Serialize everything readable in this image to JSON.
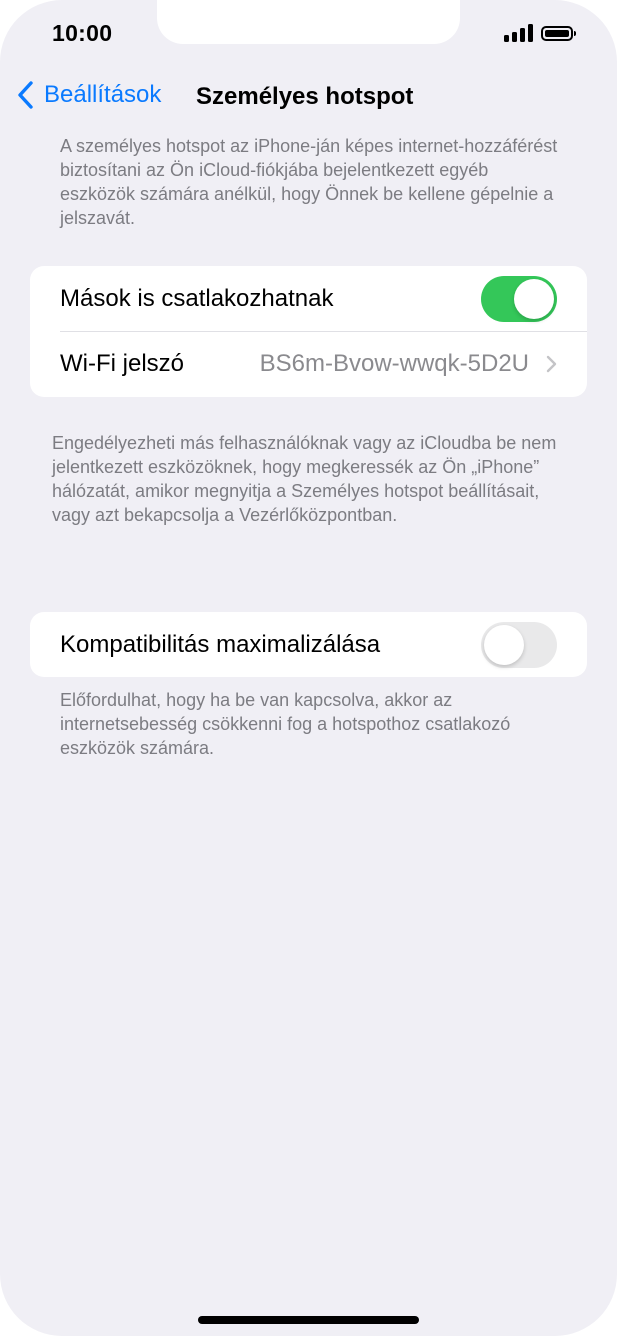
{
  "status_bar": {
    "time": "10:00",
    "signal_icon": "cellular-signal-icon",
    "battery_icon": "battery-icon",
    "battery_level": 1.0
  },
  "nav": {
    "back_label": "Beállítások",
    "back_icon": "chevron-left-icon",
    "title": "Személyes hotspot",
    "accent_color": "#0a7aff"
  },
  "intro_text": "A személyes hotspot az iPhone-ján képes internet-hozzáférést biztosítani az Ön iCloud-fiókjába bejelentkezett egyéb eszközök számára anélkül, hogy Önnek be kellene gépelnie a jelszavát.",
  "settings_group_1": {
    "allow_others": {
      "label": "Mások is csatlakozhatnak",
      "enabled": true,
      "on_color": "#34c759"
    },
    "wifi_password": {
      "label": "Wi-Fi jelszó",
      "value": "BS6m-Bvow-wwqk-5D2U",
      "chevron_icon": "chevron-right-icon"
    }
  },
  "allow_others_footer": "Engedélyezheti más felhasználóknak vagy az iCloudba be nem jelentkezett eszközöknek, hogy megkeressék az Ön „iPhone” hálózatát, amikor megnyitja a Személyes hotspot beállításait, vagy azt bekapcsolja a Vezérlőközpontban.",
  "settings_group_2": {
    "maximize_compatibility": {
      "label": "Kompatibilitás maximalizálása",
      "enabled": false
    }
  },
  "compatibility_footer": "Előfordulhat, hogy ha be van kapcsolva, akkor az internetsebesség csökkenni fog a hotspothoz csatlakozó eszközök számára."
}
